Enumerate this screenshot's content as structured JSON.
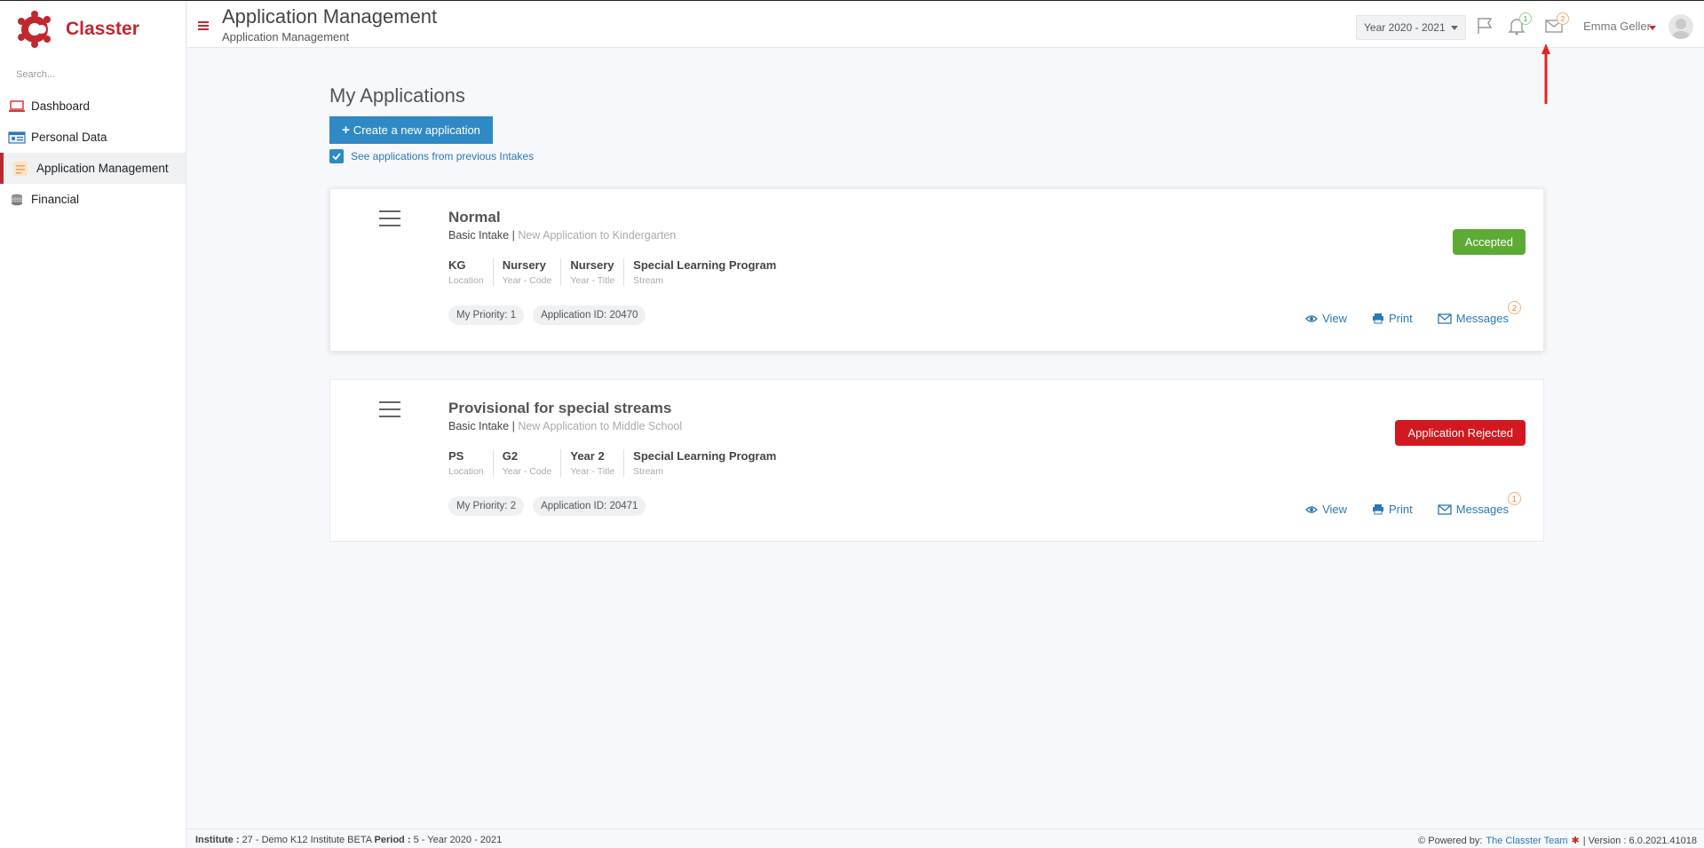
{
  "app": {
    "name": "Classter",
    "brand_color": "#c0282f"
  },
  "sidebar": {
    "search_placeholder": "Search...",
    "items": [
      {
        "label": "Dashboard",
        "icon": "laptop-icon",
        "active": false
      },
      {
        "label": "Personal Data",
        "icon": "id-card-icon",
        "active": false
      },
      {
        "label": "Application Management",
        "icon": "form-icon",
        "active": true
      },
      {
        "label": "Financial",
        "icon": "coins-icon",
        "active": false
      }
    ]
  },
  "header": {
    "title": "Application Management",
    "subtitle": "Application Management",
    "year_select": "Year 2020 - 2021",
    "notifications_count": "1",
    "messages_count": "2",
    "user_name": "Emma Geller"
  },
  "main": {
    "title": "My Applications",
    "create_button": "Create a new application",
    "checkbox_label": "See applications from previous Intakes",
    "checkbox_checked": true
  },
  "applications": [
    {
      "title": "Normal",
      "intake": "Basic Intake",
      "description": "New Application to Kindergarten",
      "meta": [
        {
          "value": "KG",
          "label": "Location"
        },
        {
          "value": "Nursery",
          "label": "Year - Code"
        },
        {
          "value": "Nursery",
          "label": "Year - Title"
        },
        {
          "value": "Special Learning Program",
          "label": "Stream"
        }
      ],
      "priority": "My Priority: 1",
      "app_id": "Application ID: 20470",
      "status": "Accepted",
      "status_color": "#5dab35",
      "actions": {
        "view": "View",
        "print": "Print",
        "messages": "Messages"
      },
      "messages_count": "2"
    },
    {
      "title": "Provisional for special streams",
      "intake": "Basic Intake",
      "description": "New Application to Middle School",
      "meta": [
        {
          "value": "PS",
          "label": "Location"
        },
        {
          "value": "G2",
          "label": "Year - Code"
        },
        {
          "value": "Year 2",
          "label": "Year - Title"
        },
        {
          "value": "Special Learning Program",
          "label": "Stream"
        }
      ],
      "priority": "My Priority: 2",
      "app_id": "Application ID: 20471",
      "status": "Application Rejected",
      "status_color": "#d4181f",
      "actions": {
        "view": "View",
        "print": "Print",
        "messages": "Messages"
      },
      "messages_count": "1"
    }
  ],
  "footer": {
    "institute_label": "Institute :",
    "institute_value": "27 - Demo K12 Institute BETA",
    "period_label": "Period :",
    "period_value": "5 - Year 2020 - 2021",
    "powered_by": "Powered by:",
    "team": "The Classter Team",
    "version": "| Version : 6.0.2021.41018"
  }
}
